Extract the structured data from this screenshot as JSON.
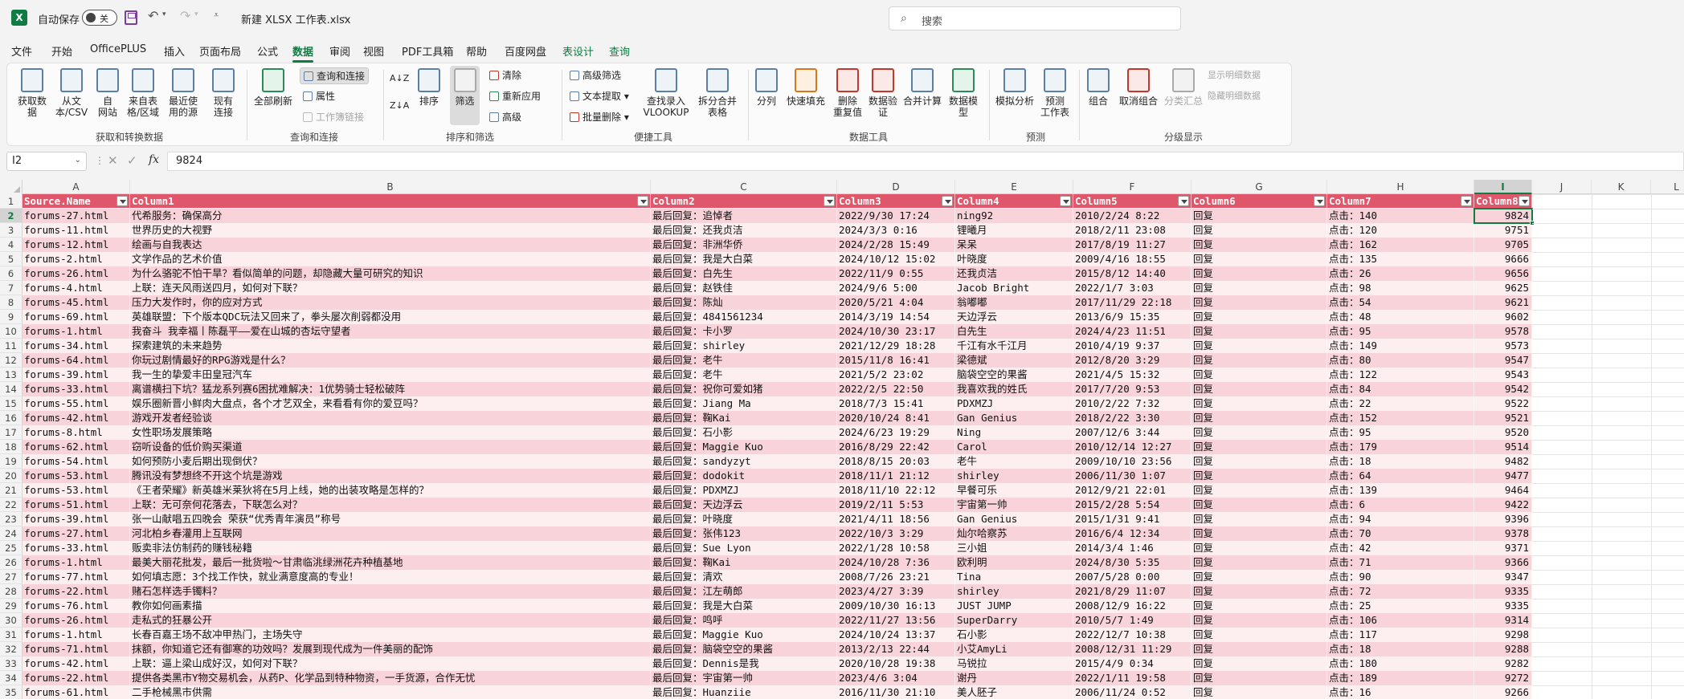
{
  "titlebar": {
    "app_icon": "X",
    "autosave_label": "自动保存",
    "autosave_state": "关",
    "doc_title": "新建 XLSX 工作表.xlsx",
    "search_placeholder": "搜索"
  },
  "menu": {
    "tabs": [
      "文件",
      "开始",
      "OfficePLUS",
      "插入",
      "页面布局",
      "公式",
      "数据",
      "审阅",
      "视图",
      "PDF工具箱",
      "帮助",
      "百度网盘",
      "表设计",
      "查询"
    ],
    "active": "数据"
  },
  "ribbon": {
    "get_data": "获取数\n据",
    "from_text": "从文\n本/CSV",
    "from_web": "自\n网站",
    "from_table": "来自表\n格/区域",
    "recent_sources": "最近使\n用的源",
    "existing_conn": "现有\n连接",
    "group_get": "获取和转换数据",
    "refresh_all": "全部刷新",
    "query_conn": "查询和连接",
    "properties": "属性",
    "edit_links": "工作簿链接",
    "group_query": "查询和连接",
    "sort_az": "A↓Z",
    "sort_za": "Z↓A",
    "sort": "排序",
    "filter": "筛选",
    "clear": "清除",
    "reapply": "重新应用",
    "advanced": "高级",
    "group_sort": "排序和筛选",
    "adv_filter": "高级筛选",
    "text_extract": "文本提取",
    "batch_delete": "批量删除",
    "lookup": "查找录入\nVLOOKUP",
    "split_merge": "拆分合并\n表格",
    "group_tools": "便捷工具",
    "text_to_col": "分列",
    "flash_fill": "快速填充",
    "remove_dup": "删除\n重复值",
    "validation": "数据验\n证",
    "consolidate": "合并计算",
    "data_model": "数据模\n型",
    "group_datatools": "数据工具",
    "what_if": "模拟分析",
    "forecast": "预测\n工作表",
    "group_forecast": "预测",
    "group": "组合",
    "ungroup": "取消组合",
    "subtotal": "分类汇总",
    "show_detail": "显示明细数据",
    "hide_detail": "隐藏明细数据",
    "group_outline": "分级显示"
  },
  "formula_bar": {
    "name_box": "I2",
    "fx": "fx",
    "value": "9824"
  },
  "columns": [
    "A",
    "B",
    "C",
    "D",
    "E",
    "F",
    "G",
    "H",
    "I",
    "J",
    "K",
    "L"
  ],
  "selected_column": "I",
  "header_row": [
    "Source.Name",
    "Column1",
    "Column2",
    "Column3",
    "Column4",
    "Column5",
    "Column6",
    "Column7",
    "Column8"
  ],
  "rows": [
    [
      "forums-27.html",
      "代希服务：确保高分",
      "最后回复：追悼者",
      "2022/9/30 17:24",
      "ning92",
      "2010/2/24 8:22",
      "回复",
      "点击：140",
      "9824"
    ],
    [
      "forums-11.html",
      "世界历史的大视野",
      "最后回复：还我贞洁",
      "2024/3/3 0:16",
      "锂曦月",
      "2018/2/11 23:08",
      "回复",
      "点击：120",
      "9751"
    ],
    [
      "forums-12.html",
      "绘画与自我表达",
      "最后回复：非洲华侨",
      "2024/2/28 15:49",
      "呆呆",
      "2017/8/19 11:27",
      "回复",
      "点击：162",
      "9705"
    ],
    [
      "forums-2.html",
      "文学作品的艺术价值",
      "最后回复：我是大白菜",
      "2024/10/12 15:02",
      "叶晓度",
      "2009/4/16 18:55",
      "回复",
      "点击：135",
      "9666"
    ],
    [
      "forums-26.html",
      "为什么骆驼不怕干旱？看似简单的问题，却隐藏大量可研究的知识",
      "最后回复：白先生",
      "2022/11/9 0:55",
      "还我贞洁",
      "2015/8/12 14:40",
      "回复",
      "点击：26",
      "9656"
    ],
    [
      "forums-4.html",
      "上联：连天风雨送四月，如何对下联？",
      "最后回复：赵铁佳",
      "2024/9/6 5:00",
      "Jacob Bright",
      "2022/1/7 3:03",
      "回复",
      "点击：98",
      "9625"
    ],
    [
      "forums-45.html",
      "压力大发作时，你的应对方式",
      "最后回复：陈灿",
      "2020/5/21 4:04",
      "翁嘟嘟",
      "2017/11/29 22:18",
      "回复",
      "点击：54",
      "9621"
    ],
    [
      "forums-69.html",
      "英雄联盟：下个版本QDC玩法又回来了，拳头屡次削弱都没用",
      "最后回复：4841561234",
      "2014/3/19 14:54",
      "天边浮云",
      "2013/6/9 15:35",
      "回复",
      "点击：48",
      "9602"
    ],
    [
      "forums-1.html",
      "我奋斗 我幸福丨陈磊平——爱在山城的杏坛守望者",
      "最后回复：卡小罗",
      "2024/10/30 23:17",
      "白先生",
      "2024/4/23 11:51",
      "回复",
      "点击：95",
      "9578"
    ],
    [
      "forums-34.html",
      "探索建筑的未来趋势",
      "最后回复：shirley",
      "2021/12/29 18:28",
      "千江有水千江月",
      "2010/4/19 9:37",
      "回复",
      "点击：149",
      "9573"
    ],
    [
      "forums-64.html",
      "你玩过剧情最好的RPG游戏是什么？",
      "最后回复：老牛",
      "2015/11/8 16:41",
      "梁德斌",
      "2012/8/20 3:29",
      "回复",
      "点击：80",
      "9547"
    ],
    [
      "forums-39.html",
      "我一生的挚爱丰田皇冠汽车",
      "最后回复：老牛",
      "2021/5/2 23:02",
      "脑袋空空的果酱",
      "2021/4/5 15:32",
      "回复",
      "点击：122",
      "9543"
    ],
    [
      "forums-33.html",
      "离谱横扫下坑？猛龙系列赛6困扰难解决：1优势骑士轻松破阵",
      "最后回复：祝你可爱如猪",
      "2022/2/5 22:50",
      "我喜欢我的姓氏",
      "2017/7/20 9:53",
      "回复",
      "点击：84",
      "9542"
    ],
    [
      "forums-55.html",
      "娱乐圈新晋小鲜肉大盘点，各个才艺双全，来看看有你的爱豆吗？",
      "最后回复：Jiang Ma",
      "2018/7/3 15:41",
      "PDXMZJ",
      "2010/2/22 7:32",
      "回复",
      "点击：22",
      "9522"
    ],
    [
      "forums-42.html",
      "游戏开发者经验谈",
      "最后回复：鞠Kai",
      "2020/10/24 8:41",
      "Gan Genius",
      "2018/2/22 3:30",
      "回复",
      "点击：152",
      "9521"
    ],
    [
      "forums-8.html",
      "女性职场发展策略",
      "最后回复：石小影",
      "2024/6/23 19:29",
      "Ning",
      "2007/12/6 3:44",
      "回复",
      "点击：95",
      "9520"
    ],
    [
      "forums-62.html",
      "窃听设备的低价购买渠道",
      "最后回复：Maggie Kuo",
      "2016/8/29 22:42",
      "Carol",
      "2010/12/14 12:27",
      "回复",
      "点击：179",
      "9514"
    ],
    [
      "forums-54.html",
      "如何预防小麦后期出现倒伏？",
      "最后回复：sandyzyt",
      "2018/8/15 20:03",
      "老牛",
      "2009/10/10 23:56",
      "回复",
      "点击：18",
      "9482"
    ],
    [
      "forums-53.html",
      "腾讯没有梦想终不开这个坑是游戏",
      "最后回复：dodokit",
      "2018/11/1 21:12",
      "shirley",
      "2006/11/30 1:07",
      "回复",
      "点击：64",
      "9477"
    ],
    [
      "forums-53.html",
      "《王者荣耀》新英雄米莱狄将在5月上线，她的出装攻略是怎样的？",
      "最后回复：PDXMZJ",
      "2018/11/10 22:12",
      "早餐可乐",
      "2012/9/21 22:01",
      "回复",
      "点击：139",
      "9464"
    ],
    [
      "forums-51.html",
      "上联：无可奈何花落去，下联怎么对？",
      "最后回复：天边浮云",
      "2019/2/11 5:53",
      "宇宙第一帅",
      "2015/2/28 5:54",
      "回复",
      "点击：6",
      "9422"
    ],
    [
      "forums-39.html",
      "张一山献唱五四晚会 荣获“优秀青年演员”称号",
      "最后回复：叶晓度",
      "2021/4/11 18:56",
      "Gan Genius",
      "2015/1/31 9:41",
      "回复",
      "点击：94",
      "9396"
    ],
    [
      "forums-27.html",
      "河北柏乡春灌用上互联网",
      "最后回复：张伟123",
      "2022/10/3 3:29",
      "灿尔哈察苏",
      "2016/6/4 12:34",
      "回复",
      "点击：70",
      "9378"
    ],
    [
      "forums-33.html",
      "贩卖非法仿制药的赚钱秘籍",
      "最后回复：Sue Lyon",
      "2022/1/28 10:58",
      "三小姐",
      "2014/3/4 1:46",
      "回复",
      "点击：42",
      "9371"
    ],
    [
      "forums-1.html",
      "最美大丽花批发，最后一批货啦～甘肃临洮绿洲花卉种植基地",
      "最后回复：鞠Kai",
      "2024/10/28 7:36",
      "欧利明",
      "2024/8/30 5:35",
      "回复",
      "点击：71",
      "9366"
    ],
    [
      "forums-77.html",
      "如何填志愿：3个找工作快，就业满意度高的专业！",
      "最后回复：清欢",
      "2008/7/26 23:21",
      "Tina",
      "2007/5/28 0:00",
      "回复",
      "点击：90",
      "9347"
    ],
    [
      "forums-22.html",
      "赌石怎样选手镯料？",
      "最后回复：江左萌郎",
      "2023/4/27 3:39",
      "shirley",
      "2021/8/29 11:07",
      "回复",
      "点击：72",
      "9335"
    ],
    [
      "forums-76.html",
      "教你如何画素描",
      "最后回复：我是大白菜",
      "2009/10/30 16:13",
      "JUST JUMP",
      "2008/12/9 16:22",
      "回复",
      "点击：25",
      "9335"
    ],
    [
      "forums-26.html",
      "走私式的狂暴公开",
      "最后回复：鸣呼",
      "2022/11/27 13:56",
      "SuperDarry",
      "2010/5/7 1:49",
      "回复",
      "点击：106",
      "9314"
    ],
    [
      "forums-1.html",
      "长春百嘉王场不敌冲甲热门，主场失守",
      "最后回复：Maggie Kuo",
      "2024/10/24 13:37",
      "石小影",
      "2022/12/7 10:38",
      "回复",
      "点击：117",
      "9298"
    ],
    [
      "forums-71.html",
      "抹额，你知道它还有御寒的功效吗？发展到现代成为一件美丽的配饰",
      "最后回复：脑袋空空的果酱",
      "2013/2/13 22:44",
      "小艾AmyLi",
      "2008/12/31 11:29",
      "回复",
      "点击：18",
      "9288"
    ],
    [
      "forums-42.html",
      "上联：逼上梁山成好汉，如何对下联？",
      "最后回复：Dennis是我",
      "2020/10/28 19:38",
      "马锐拉",
      "2015/4/9 0:34",
      "回复",
      "点击：180",
      "9282"
    ],
    [
      "forums-22.html",
      "提供各类黑市Y物交易机会，从药P、化学品到特种物资，一手货源，合作无忧",
      "最后回复：宇宙第一帅",
      "2023/4/6 3:04",
      "谢丹",
      "2022/1/11 19:58",
      "回复",
      "点击：189",
      "9272"
    ],
    [
      "forums-61.html",
      "二手枪械黑市供需",
      "最后回复：Huanziie",
      "2016/11/30 21:10",
      "美人胚子",
      "2006/11/24 0:52",
      "回复",
      "点击：16",
      "9266"
    ]
  ]
}
